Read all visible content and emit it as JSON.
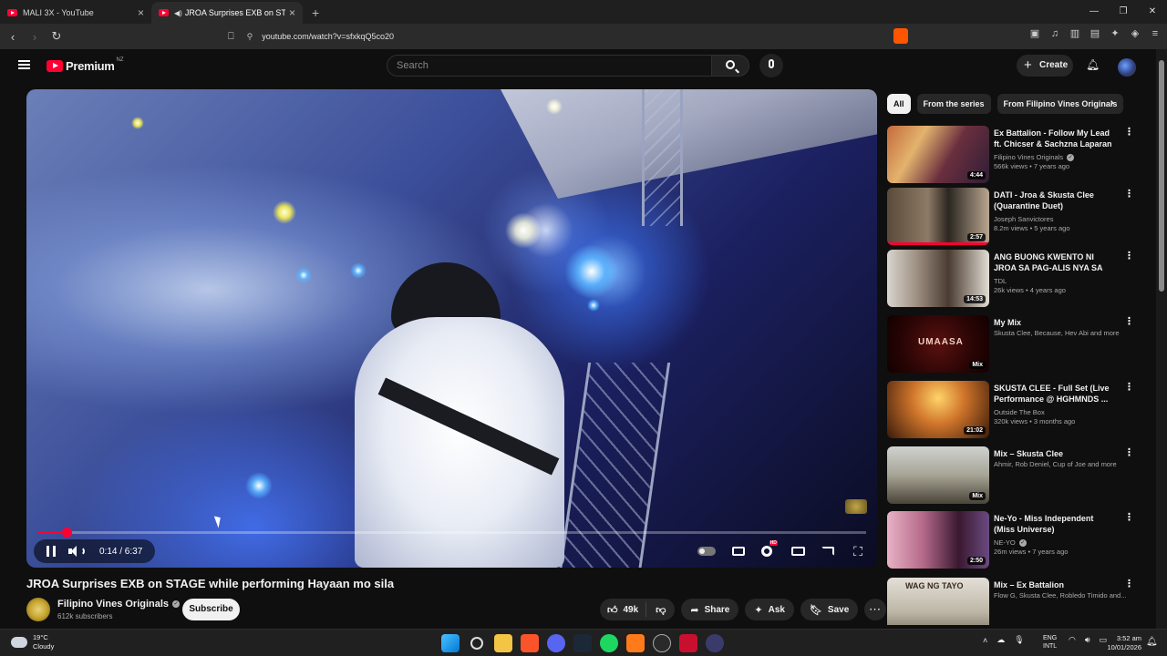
{
  "browser": {
    "tabs": [
      {
        "title": "MALI 3X - YouTube"
      },
      {
        "title": "JROA Surprises EXB on STAGE",
        "active": true
      }
    ],
    "url": "youtube.com/watch?v=sfxkqQ5co20"
  },
  "header": {
    "brand": "Premium",
    "region": "NZ",
    "search_placeholder": "Search",
    "create_label": "Create"
  },
  "player": {
    "time": "0:14 / 6:37",
    "progress_fraction": 0.035,
    "state": "playing"
  },
  "video": {
    "title": "JROA Surprises EXB on STAGE while performing Hayaan mo sila",
    "channel": "Filipino Vines Originals",
    "subscribers": "612k subscribers",
    "subscribe_label": "Subscribe",
    "likes": "49k",
    "share_label": "Share",
    "ask_label": "Ask",
    "save_label": "Save"
  },
  "chips": [
    "All",
    "From the series",
    "From Filipino Vines Originals"
  ],
  "recommendations": [
    {
      "title": "Ex Battalion - Follow My Lead ft. Chicser & Sachzna Laparan ...",
      "channel": "Filipino Vines Originals",
      "verified": true,
      "meta": "566k views • 7 years ago",
      "badge": "4:44"
    },
    {
      "title": "DATI - Jroa & Skusta Clee (Quarantine Duet)",
      "channel": "Joseph Sanvictores",
      "verified": false,
      "meta": "8.2m views • 5 years ago",
      "badge": "2:57"
    },
    {
      "title": "ANG BUONG KWENTO NI JROA SA PAG-ALIS NYA SA EXB ...",
      "channel": "TDL",
      "verified": false,
      "meta": "26k views • 4 years ago",
      "badge": "14:53"
    },
    {
      "title": "My Mix",
      "channel": "Skusta Clee, Because, Hev Abi and more",
      "verified": false,
      "meta": "",
      "badge": "Mix",
      "thumb_text": "UMAASA"
    },
    {
      "title": "SKUSTA CLEE - Full Set (Live Performance @ HGHMNDS ...",
      "channel": "Outside The Box",
      "verified": false,
      "meta": "320k views • 3 months ago",
      "badge": "21:02"
    },
    {
      "title": "Mix – Skusta Clee",
      "channel": "Ahmir, Rob Deniel, Cup of Joe and more",
      "verified": false,
      "meta": "",
      "badge": "Mix"
    },
    {
      "title": "Ne-Yo - Miss Independent (Miss Universe)",
      "channel": "NE-YO",
      "verified": true,
      "meta": "26m views • 7 years ago",
      "badge": "2:50"
    },
    {
      "title": "Mix – Ex Battalion",
      "channel": "Flow G, Skusta Clee, Robledo Timido and...",
      "verified": false,
      "meta": "",
      "badge": "",
      "thumb_text": "WAG NG TAYO"
    }
  ],
  "taskbar": {
    "temp": "19°C",
    "weather": "Cloudy",
    "lang1": "ENG",
    "lang2": "INTL",
    "time": "3:52 am",
    "date": "10/01/2026"
  },
  "colors": {
    "accent": "#ff0033",
    "background": "#0f0f0f",
    "surface": "#272727"
  }
}
